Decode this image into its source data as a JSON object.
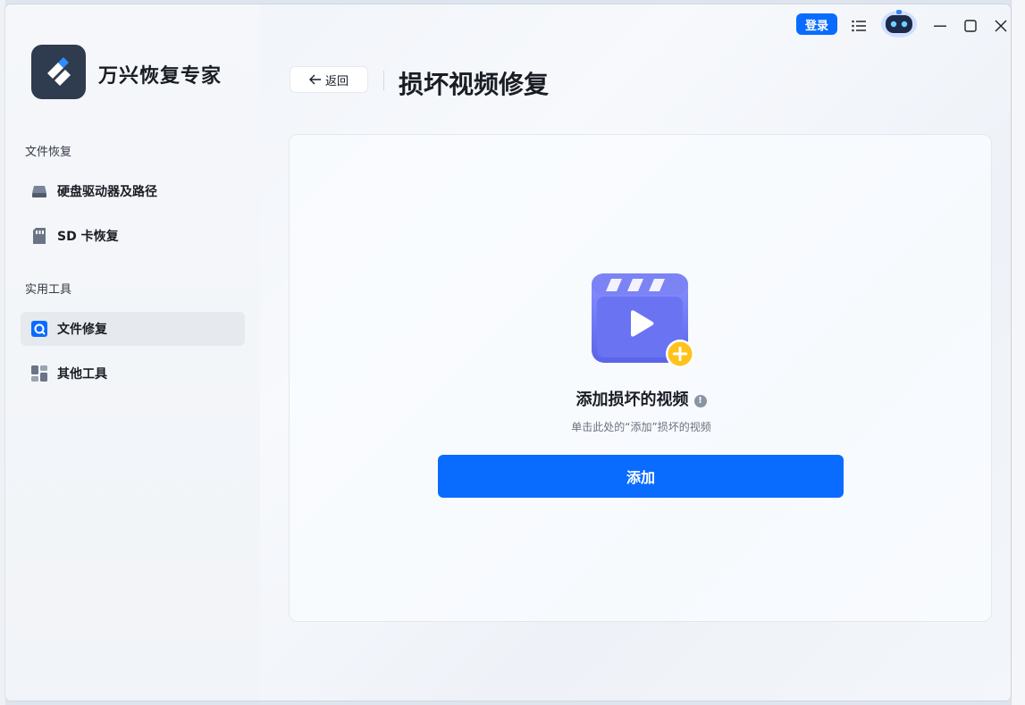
{
  "app": {
    "name": "万兴恢复专家"
  },
  "sidebar": {
    "sections": [
      {
        "label": "文件恢复",
        "items": [
          {
            "label": "硬盘驱动器及路径",
            "icon": "hard-drive-icon"
          },
          {
            "label": "SD 卡恢复",
            "icon": "sd-card-icon"
          }
        ]
      },
      {
        "label": "实用工具",
        "items": [
          {
            "label": "文件修复",
            "icon": "file-repair-icon",
            "active": true
          },
          {
            "label": "其他工具",
            "icon": "other-tools-icon"
          }
        ]
      }
    ]
  },
  "topbar": {
    "login_label": "登录",
    "icons": [
      "menu-icon",
      "assistant-robot-icon",
      "minimize-icon",
      "maximize-icon",
      "close-icon"
    ]
  },
  "header": {
    "back_label": "返回",
    "title": "损坏视频修复"
  },
  "main": {
    "empty_title": "添加损坏的视频",
    "empty_subtitle": "单击此处的“添加”损坏的视频",
    "add_button_label": "添加"
  },
  "colors": {
    "accent": "#0a6cff",
    "video_icon": "#6b74f0",
    "plus_badge": "#ffc21a"
  }
}
